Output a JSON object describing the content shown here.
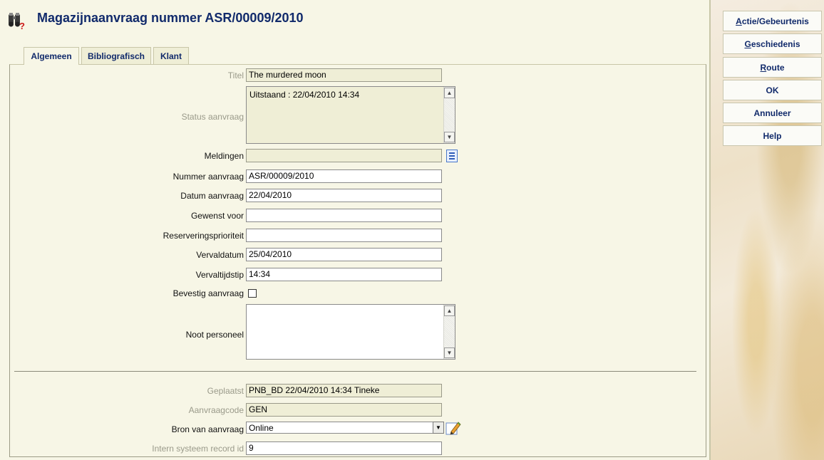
{
  "page": {
    "title": "Magazijnaanvraag nummer ASR/00009/2010"
  },
  "tabs": [
    {
      "label": "Algemeen",
      "active": true
    },
    {
      "label": "Bibliografisch",
      "active": false
    },
    {
      "label": "Klant",
      "active": false
    }
  ],
  "form": {
    "titel": {
      "label": "Titel",
      "value": "The murdered moon"
    },
    "status": {
      "label": "Status aanvraag",
      "value": "Uitstaand : 22/04/2010 14:34"
    },
    "meldingen": {
      "label": "Meldingen",
      "value": ""
    },
    "nummer": {
      "label": "Nummer aanvraag",
      "value": "ASR/00009/2010"
    },
    "datum": {
      "label": "Datum aanvraag",
      "value": "22/04/2010"
    },
    "gewenst": {
      "label": "Gewenst voor",
      "value": ""
    },
    "prioriteit": {
      "label": "Reserveringsprioriteit",
      "value": ""
    },
    "vervaldatum": {
      "label": "Vervaldatum",
      "value": "25/04/2010"
    },
    "vervaltijdstip": {
      "label": "Vervaltijdstip",
      "value": "14:34"
    },
    "bevestig": {
      "label": "Bevestig aanvraag",
      "checked": false
    },
    "noot": {
      "label": "Noot personeel",
      "value": ""
    },
    "geplaatst": {
      "label": "Geplaatst",
      "value": "PNB_BD 22/04/2010 14:34 Tineke"
    },
    "aanvraagcode": {
      "label": "Aanvraagcode",
      "value": "GEN"
    },
    "bron": {
      "label": "Bron van aanvraag",
      "value": "Online"
    },
    "record_id": {
      "label": "Intern systeem record id",
      "value": "9"
    }
  },
  "sidebar": {
    "actie_first": "A",
    "actie_rest": "ctie/Gebeurtenis",
    "geschiedenis_first": "G",
    "geschiedenis_rest": "eschiedenis",
    "route_first": "R",
    "route_rest": "oute",
    "ok": "OK",
    "annuleer": "Annuleer",
    "help": "Help"
  },
  "icons": {
    "title": "binoculars-question-icon",
    "meldingen": "list-icon",
    "select_arrow": "chevron-down-icon",
    "edit": "pencil-icon"
  },
  "colors": {
    "title": "#112a6b",
    "panel_bg": "#f7f6e6",
    "readonly_bg": "#efeed6"
  }
}
